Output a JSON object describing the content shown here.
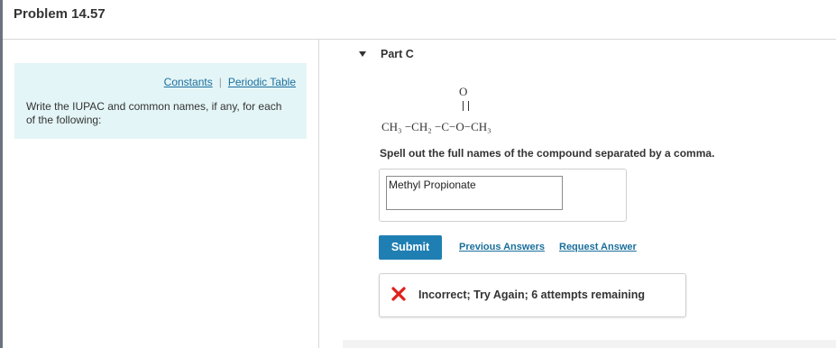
{
  "page": {
    "title": "Problem 14.57"
  },
  "left_panel": {
    "constants_link": "Constants",
    "separator": "|",
    "periodic_table_link": "Periodic Table",
    "instructions": "Write the IUPAC and common names, if any, for each of the following:"
  },
  "part": {
    "label": "Part C",
    "formula": {
      "top_atom": "O",
      "chain": "CH₃ −CH₂ −C−O−CH₃"
    },
    "prompt": "Spell out the full names of the compound separated by a comma.",
    "answer_value": "Methyl Propionate",
    "submit_label": "Submit",
    "previous_answers_label": "Previous Answers",
    "request_answer_label": "Request Answer",
    "feedback": "Incorrect; Try Again; 6 attempts remaining"
  },
  "colors": {
    "panel_bg": "#e4f5f7",
    "link": "#1a6f9c",
    "submit_bg": "#1f7fb3",
    "error": "#e0201c"
  },
  "icons": {
    "collapse": "triangle-down-icon",
    "error": "x-mark-icon"
  }
}
